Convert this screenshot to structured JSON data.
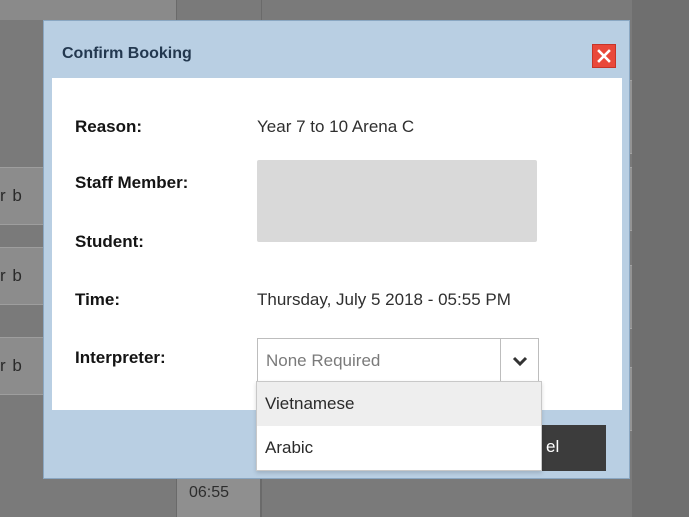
{
  "background": {
    "side_label_fragment": "r b",
    "time_label": "06:55"
  },
  "dialog": {
    "title": "Confirm Booking",
    "close_glyph": "✕",
    "fields": {
      "reason_label": "Reason:",
      "reason_value": "Year 7 to 10 Arena C",
      "staff_label": "Staff Member:",
      "student_label": "Student:",
      "time_label": "Time:",
      "time_value": "Thursday, July 5 2018 - 05:55 PM",
      "interpreter_label": "Interpreter:"
    },
    "interpreter_select": {
      "selected": "None Required",
      "options": [
        "Vietnamese",
        "Arabic"
      ],
      "highlighted_option": "Vietnamese"
    },
    "cancel_button_label_visible": "el"
  },
  "colors": {
    "dialog_header": "#b9cfe3",
    "title_text": "#23384f",
    "close_button": "#e9483a",
    "cancel_button": "#3c3c3c",
    "overlay": "#7a7a7a"
  }
}
